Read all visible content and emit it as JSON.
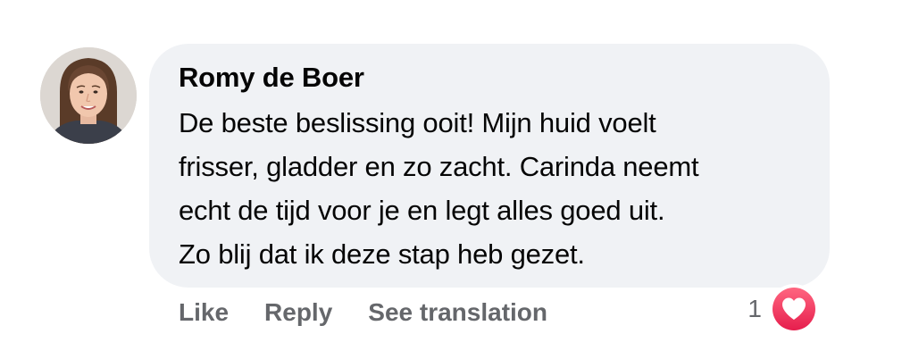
{
  "comment": {
    "author": "Romy de Boer",
    "avatar_icon": "profile-photo",
    "text": "De beste beslissing ooit! Mijn huid voelt\nfrisser, gladder en zo zacht. Carinda neemt\necht de tijd voor je en legt alles goed uit.\nZo blij dat ik deze stap heb gezet.",
    "actions": {
      "like_label": "Like",
      "reply_label": "Reply",
      "translate_label": "See translation"
    },
    "reactions": {
      "count": "1",
      "icon": "heart-icon",
      "color": "#f02849"
    },
    "bubble_color": "#f0f2f5"
  }
}
